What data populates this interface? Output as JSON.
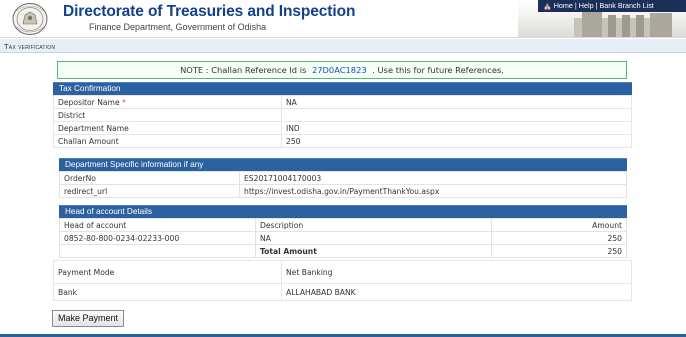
{
  "header": {
    "title": "Directorate of Treasuries and Inspection",
    "subtitle": "Finance Department, Government of Odisha",
    "links": [
      "Home",
      "Help",
      "Bank Branch List"
    ],
    "separator": "|",
    "home_icon": "home-icon"
  },
  "page": {
    "title": "Tax verification"
  },
  "note": {
    "prefix": "NOTE : Challan Reference Id is",
    "reference_id": "27D0AC1823",
    "suffix": ". Use this for future References."
  },
  "tax_confirmation": {
    "title": "Tax Confirmation",
    "rows": [
      {
        "label": "Depositor Name",
        "required": "*",
        "value": "NA"
      },
      {
        "label": "District",
        "value": ""
      },
      {
        "label": "Department Name",
        "value": "IND"
      },
      {
        "label": "Challan Amount",
        "value": "250"
      }
    ]
  },
  "department_info": {
    "title": "Department Specific information if any",
    "rows": [
      {
        "label": "OrderNo",
        "value": "ES20171004170003"
      },
      {
        "label": "redirect_url",
        "value": "https://invest.odisha.gov.in/PaymentThankYou.aspx"
      }
    ]
  },
  "head_of_account": {
    "title": "Head of account Details",
    "columns": [
      "Head of account",
      "Description",
      "Amount"
    ],
    "rows": [
      {
        "account": "0852-80-800-0234-02233-000",
        "description": "NA",
        "amount": "250"
      }
    ],
    "total_label": "Total Amount",
    "total_amount": "250"
  },
  "payment": {
    "mode_label": "Payment Mode",
    "mode_value": "Net Banking",
    "bank_label": "Bank",
    "bank_value": "ALLAHABAD BANK"
  },
  "actions": {
    "make_payment_label": "Make Payment"
  },
  "colors": {
    "section_header": "#2b61a0",
    "title_blue": "#13418d",
    "note_border": "#5ab67a",
    "reference_blue": "#1b4fb5",
    "required_red": "#e23a3a"
  }
}
